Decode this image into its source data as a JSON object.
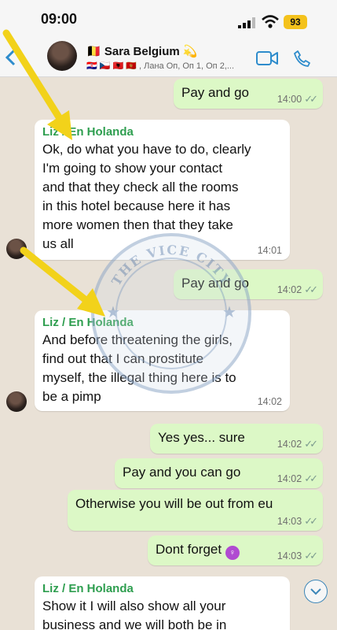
{
  "status_bar": {
    "time": "09:00",
    "battery": "93"
  },
  "header": {
    "contact_name": "🇧🇪 Sara Belgium 💫",
    "contact_subtitle": "🇭🇷 🇨🇿 🇦🇱 🇲🇪 , Лана Оп, Оп 1, Оп 2,..."
  },
  "watermark_text": "THE VICE CITY",
  "messages": [
    {
      "dir": "out",
      "text": "Pay and go",
      "time": "14:00"
    },
    {
      "dir": "in",
      "sender": "Liz / En Holanda",
      "lines": [
        "Ok, do what you have to do, clearly",
        "I'm going to show your contact",
        "and that they check all the rooms",
        "in this hotel because here it has",
        "more women then that they take",
        "us all"
      ],
      "time": "14:01"
    },
    {
      "dir": "out",
      "text": "Pay and go",
      "time": "14:02"
    },
    {
      "dir": "in",
      "sender": "Liz / En Holanda",
      "lines": [
        "And before threatening the girls,",
        "find out that I can prostitute",
        "myself, the illegal thing here is to",
        "be a pimp"
      ],
      "time": "14:02"
    },
    {
      "dir": "out",
      "text": "Yes yes... sure",
      "time": "14:02"
    },
    {
      "dir": "out",
      "text": "Pay and you can go",
      "time": "14:02"
    },
    {
      "dir": "out",
      "text": "Otherwise you will be out from eu",
      "time": "14:03"
    },
    {
      "dir": "out",
      "text": "Dont forget",
      "emoji": "🤷‍♀️",
      "time": "14:03"
    },
    {
      "dir": "in",
      "sender": "Liz / En Holanda",
      "lines": [
        "Show it I will also show all your",
        "business and we will both be in"
      ]
    }
  ],
  "colors": {
    "outgoing_bubble": "#dcf8c6",
    "incoming_bubble": "#ffffff",
    "sender_name": "#2e9e4f",
    "annotation_arrow": "#f2d21a"
  }
}
